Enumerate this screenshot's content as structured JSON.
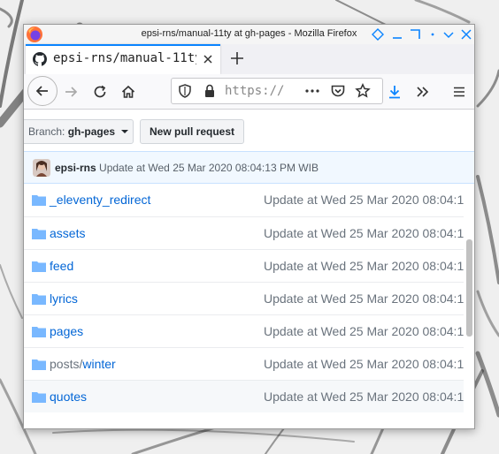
{
  "window": {
    "title": "epsi-rns/manual-11ty at gh-pages - Mozilla Firefox"
  },
  "tab": {
    "title": "epsi-rns/manual-11ty",
    "icon": "github-icon"
  },
  "navbar": {
    "url_text": "https://",
    "icons": [
      "back-arrow-icon",
      "forward-arrow-icon",
      "reload-icon",
      "home-icon",
      "shield-icon",
      "lock-icon",
      "more-icon",
      "pocket-icon",
      "star-icon",
      "download-icon",
      "overflow-icon",
      "menu-icon"
    ]
  },
  "repo": {
    "branch_label": "Branch:",
    "branch_name": "gh-pages",
    "new_pr_label": "New pull request",
    "commit_author": "epsi-rns",
    "commit_message": "Update at Wed 25 Mar 2020 08:04:13 PM WIB"
  },
  "files": [
    {
      "name": "_eleventy_redirect",
      "message": "Update at Wed 25 Mar 2020 08:04:1"
    },
    {
      "name": "assets",
      "message": "Update at Wed 25 Mar 2020 08:04:1"
    },
    {
      "name": "feed",
      "message": "Update at Wed 25 Mar 2020 08:04:1"
    },
    {
      "name": "lyrics",
      "message": "Update at Wed 25 Mar 2020 08:04:1"
    },
    {
      "name": "pages",
      "message": "Update at Wed 25 Mar 2020 08:04:1"
    },
    {
      "name_prefix": "posts/",
      "name": "winter",
      "message": "Update at Wed 25 Mar 2020 08:04:1"
    },
    {
      "name": "quotes",
      "message": "Update at Wed 25 Mar 2020 08:04:1"
    }
  ],
  "colors": {
    "link": "#0366d6",
    "muted": "#6a737d",
    "folder": "#79b8ff",
    "accent": "#0a84ff"
  }
}
